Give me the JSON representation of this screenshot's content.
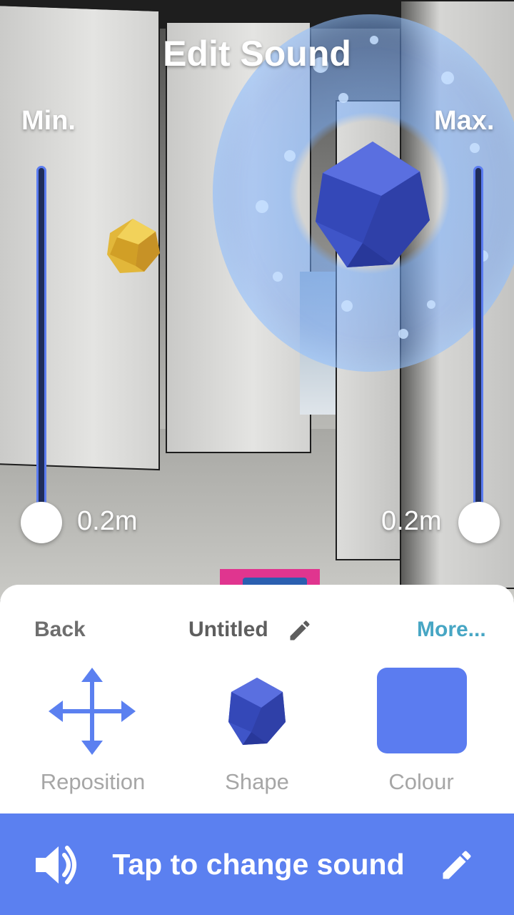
{
  "header": {
    "title": "Edit Sound"
  },
  "sliders": {
    "min": {
      "label": "Min.",
      "value_text": "0.2m",
      "level": 0.0
    },
    "max": {
      "label": "Max.",
      "value_text": "0.2m",
      "level": 0.0
    }
  },
  "sheet": {
    "back_label": "Back",
    "name": "Untitled",
    "more_label": "More...",
    "tools": [
      {
        "label": "Reposition",
        "icon": "move-arrows-icon"
      },
      {
        "label": "Shape",
        "icon": "icosahedron-icon"
      },
      {
        "label": "Colour",
        "icon": "colour-swatch-icon"
      }
    ]
  },
  "footer": {
    "action_label": "Tap to change sound",
    "left_icon": "speaker-icon",
    "right_icon": "pencil-icon"
  },
  "colors": {
    "accent": "#5b80f0",
    "link": "#47a6c4",
    "swatch": "#5b7cf0"
  }
}
